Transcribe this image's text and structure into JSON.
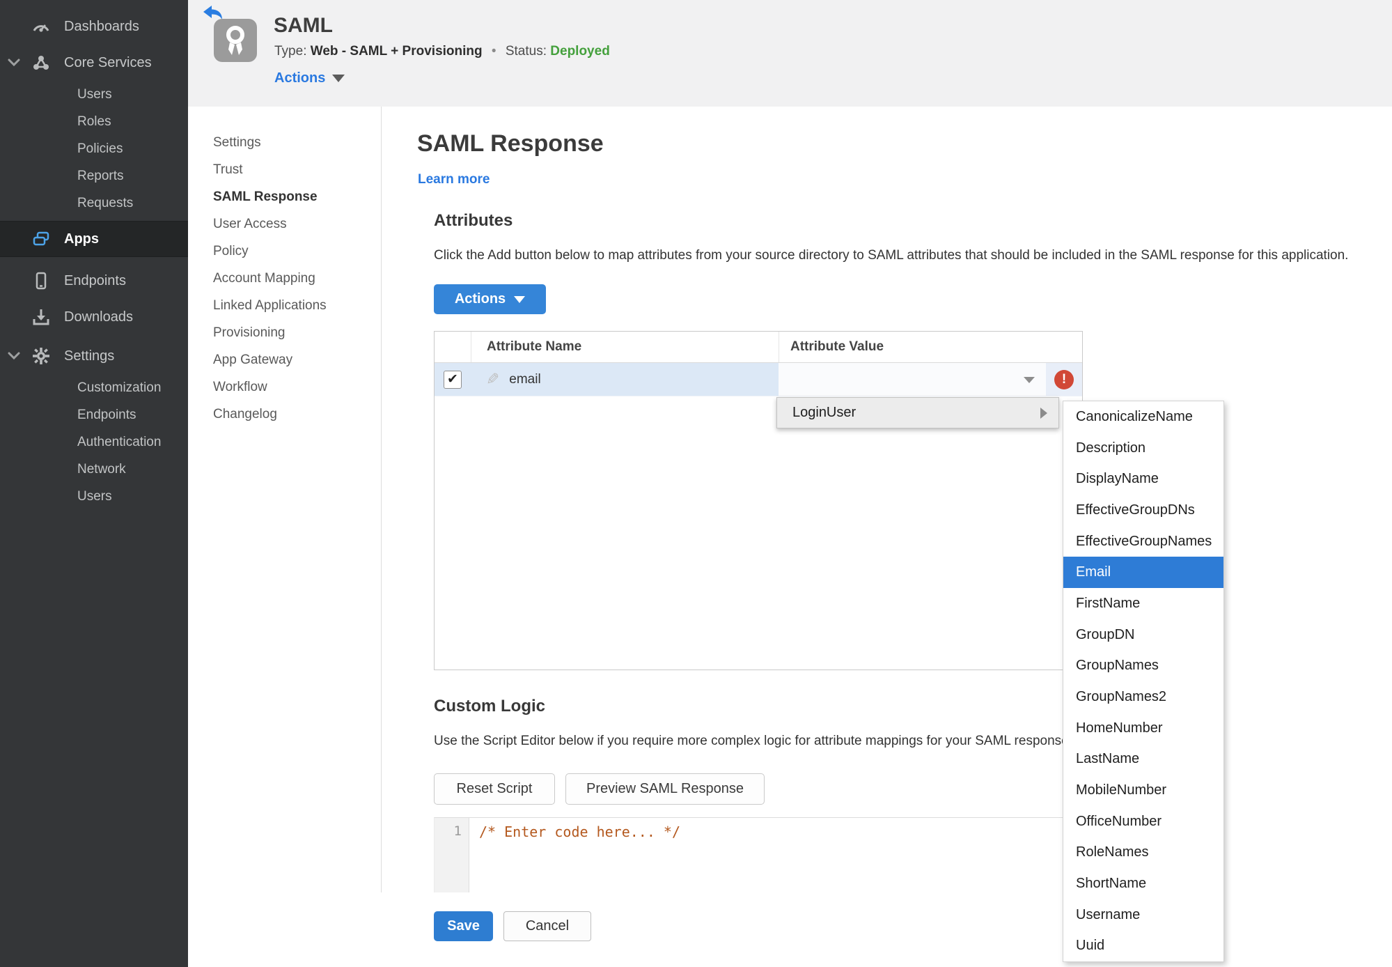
{
  "colors": {
    "accent_blue": "#2e7dd1",
    "link_blue": "#2a79e0",
    "status_green": "#44a03c",
    "error_red": "#d14836",
    "sidebar_bg": "#343638",
    "row_highlight": "#dce8f6"
  },
  "sidebar": {
    "items": [
      {
        "label": "Dashboards"
      },
      {
        "label": "Core Services",
        "expanded": true
      },
      {
        "label": "Users"
      },
      {
        "label": "Roles"
      },
      {
        "label": "Policies"
      },
      {
        "label": "Reports"
      },
      {
        "label": "Requests"
      },
      {
        "label": "Apps",
        "active": true
      },
      {
        "label": "Endpoints"
      },
      {
        "label": "Downloads"
      },
      {
        "label": "Settings",
        "expanded": true
      },
      {
        "label": "Customization"
      },
      {
        "label": "Endpoints"
      },
      {
        "label": "Authentication"
      },
      {
        "label": "Network"
      },
      {
        "label": "Users"
      }
    ]
  },
  "header": {
    "title": "SAML",
    "type_label": "Type:",
    "type_value": "Web - SAML + Provisioning",
    "separator": "•",
    "status_label": "Status:",
    "status_value": "Deployed",
    "actions_label": "Actions"
  },
  "subnav": {
    "items": [
      {
        "label": "Settings"
      },
      {
        "label": "Trust"
      },
      {
        "label": "SAML Response",
        "active": true
      },
      {
        "label": "User Access"
      },
      {
        "label": "Policy"
      },
      {
        "label": "Account Mapping"
      },
      {
        "label": "Linked Applications"
      },
      {
        "label": "Provisioning"
      },
      {
        "label": "App Gateway"
      },
      {
        "label": "Workflow"
      },
      {
        "label": "Changelog"
      }
    ]
  },
  "main": {
    "page_title": "SAML Response",
    "learn_more": "Learn more",
    "attributes_heading": "Attributes",
    "attributes_description": "Click the Add button below to map attributes from your source directory to SAML attributes that should be included in the SAML response for this application.",
    "actions_button": "Actions",
    "table": {
      "columns": [
        "Attribute Name",
        "Attribute Value"
      ],
      "row": {
        "checked": "✔",
        "name": "email",
        "value": ""
      }
    },
    "custom_logic_heading": "Custom Logic",
    "custom_logic_description": "Use the Script Editor below if you require more complex logic for attribute mappings for your SAML response.",
    "reset_button": "Reset Script",
    "preview_button": "Preview SAML Response",
    "editor": {
      "line_number": "1",
      "code": "/* Enter code here... */"
    },
    "save_button": "Save",
    "cancel_button": "Cancel"
  },
  "context_menu": {
    "label": "LoginUser",
    "submenu": {
      "selected": "Email",
      "items": [
        "CanonicalizeName",
        "Description",
        "DisplayName",
        "EffectiveGroupDNs",
        "EffectiveGroupNames",
        "Email",
        "FirstName",
        "GroupDN",
        "GroupNames",
        "GroupNames2",
        "HomeNumber",
        "LastName",
        "MobileNumber",
        "OfficeNumber",
        "RoleNames",
        "ShortName",
        "Username",
        "Uuid"
      ]
    }
  }
}
